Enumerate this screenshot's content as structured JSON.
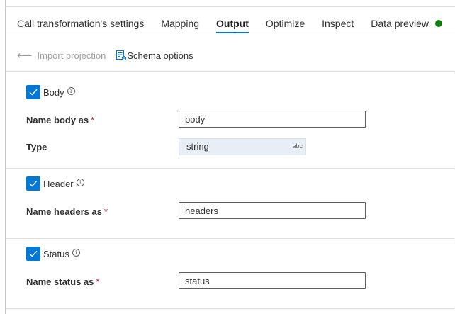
{
  "tabs": [
    {
      "label": "Call transformation's settings",
      "active": false
    },
    {
      "label": "Mapping",
      "active": false
    },
    {
      "label": "Output",
      "active": true
    },
    {
      "label": "Optimize",
      "active": false
    },
    {
      "label": "Inspect",
      "active": false
    },
    {
      "label": "Data preview",
      "active": false
    }
  ],
  "toolbar": {
    "import_label": "Import projection",
    "schema_label": "Schema options"
  },
  "body": {
    "checkbox_label": "Body",
    "checked": true,
    "name_label": "Name body as",
    "name_value": "body",
    "type_label": "Type",
    "type_value": "string",
    "type_badge": "abc"
  },
  "header": {
    "checkbox_label": "Header",
    "checked": true,
    "name_label": "Name headers as",
    "name_value": "headers"
  },
  "status": {
    "checkbox_label": "Status",
    "checked": true,
    "name_label": "Name status as",
    "name_value": "status"
  },
  "required_marker": "*",
  "info_glyph": "i",
  "colors": {
    "accent": "#0078d4",
    "status_ok": "#107c10",
    "required": "#a4262c"
  }
}
